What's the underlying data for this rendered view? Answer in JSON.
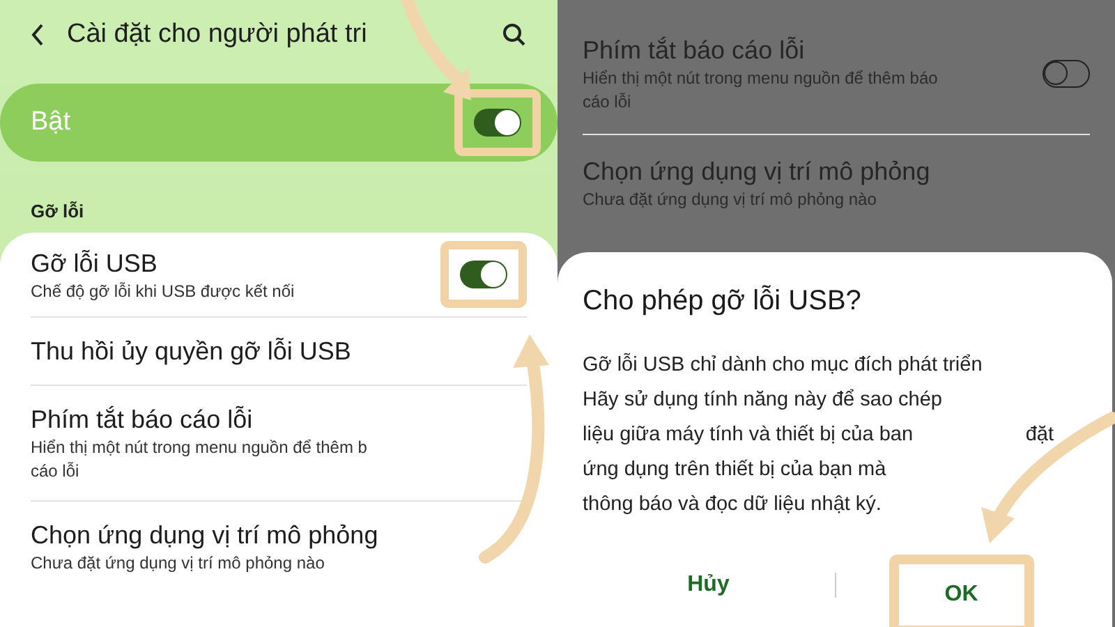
{
  "left": {
    "header": {
      "title": "Cài đặt cho người phát tri"
    },
    "master_switch": {
      "label": "Bật",
      "on": true,
      "highlighted": true
    },
    "section": "Gỡ lỗi",
    "items": [
      {
        "title": "Gỡ lỗi USB",
        "subtitle_lines": [
          "Chế độ gỡ lỗi khi USB được kết nối"
        ],
        "kind": "switch",
        "on": true,
        "highlighted": true
      },
      {
        "title": "Thu hồi ủy quyền gỡ lỗi USB",
        "kind": "plain"
      },
      {
        "title": "Phím tắt báo cáo lỗi",
        "subtitle_lines": [
          "Hiển thị một nút trong menu nguồn để thêm b",
          "cáo lỗi"
        ],
        "kind": "plain"
      },
      {
        "title": "Chọn ứng dụng vị trí mô phỏng",
        "subtitle_lines": [
          "Chưa đặt ứng dụng vị trí mô phỏng nào"
        ],
        "kind": "plain"
      }
    ]
  },
  "right": {
    "items": [
      {
        "title": "Phím tắt báo cáo lỗi",
        "subtitle_lines": [
          "Hiển thị một nút trong menu nguồn để thêm báo",
          "cáo lỗi"
        ],
        "kind": "switch",
        "on": false,
        "highlighted": false
      },
      {
        "title": "Chọn ứng dụng vị trí mô phỏng",
        "subtitle_lines": [
          "Chưa đặt ứng dụng vị trí mô phỏng nào"
        ],
        "kind": "plain"
      }
    ],
    "dialog": {
      "title": "Cho phép gỡ lỗi USB?",
      "body_lines": [
        [
          "Gỡ lỗi USB chỉ dành cho mục đích phát triển"
        ],
        [
          "Hãy sử dụng tính năng này để sao chép"
        ],
        [
          "liệu giữa máy tính và thiết bị của ban",
          "đặt"
        ],
        [
          "ứng dụng trên thiết bị của bạn mà"
        ],
        [
          "thông báo và đọc dữ liệu nhật ký."
        ]
      ],
      "buttons": [
        {
          "label": "Hủy",
          "highlighted": false
        },
        {
          "label": "OK",
          "highlighted": true
        }
      ]
    }
  }
}
